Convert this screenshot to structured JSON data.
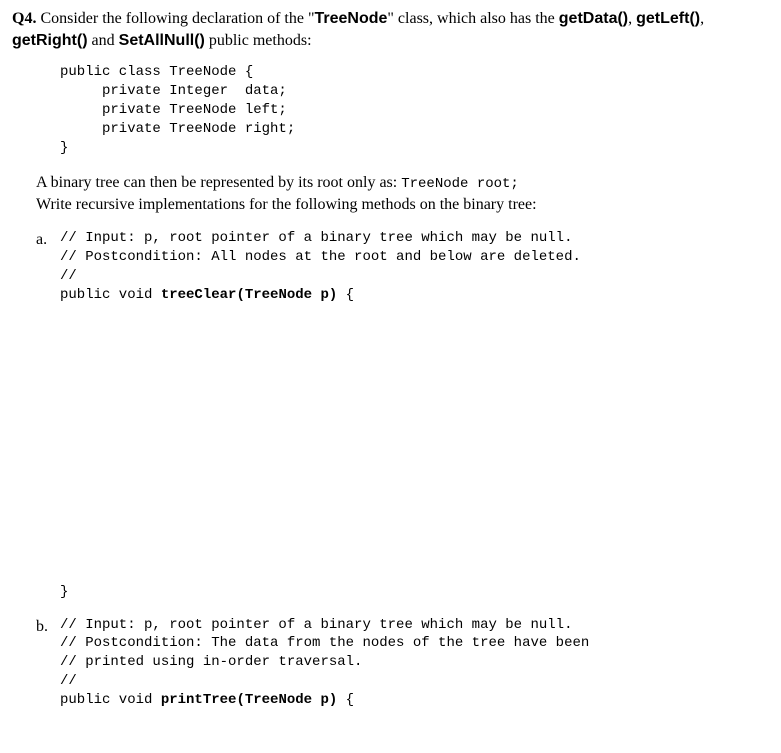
{
  "question": {
    "label": "Q4.",
    "intro_text_1": "Consider the following declaration of the \"",
    "class_name": "TreeNode",
    "intro_text_2": "\" class, which also has the ",
    "method1": "getData()",
    "sep1": ", ",
    "method2": "getLeft()",
    "sep2": ", ",
    "method3": "getRight()",
    "sep3": " and ",
    "method4": "SetAllNull()",
    "intro_text_3": " public methods:"
  },
  "class_code": "public class TreeNode {\n     private Integer  data;\n     private TreeNode left;\n     private TreeNode right;\n}",
  "description": {
    "line1_pre": "A binary tree can then be represented by its root only as:  ",
    "line1_code": "TreeNode root;",
    "line2": "Write recursive implementations for the following methods on the binary tree:"
  },
  "part_a": {
    "label": "a.",
    "comment1": "// Input: p, root pointer of a binary tree which may be null.",
    "comment2": "// Postcondition: All nodes at the root and below are deleted.",
    "comment3": "//",
    "sig_pre": "public void ",
    "sig_bold": "treeClear(TreeNode p)",
    "sig_post": " {",
    "close": "}"
  },
  "part_b": {
    "label": "b.",
    "comment1": "// Input: p, root pointer of a binary tree which may be null.",
    "comment2": "// Postcondition: The data from the nodes of the tree have been",
    "comment3": "// printed using in-order traversal.",
    "comment4": "//",
    "sig_pre": "public void ",
    "sig_bold": "printTree(TreeNode p)",
    "sig_post": " {"
  }
}
